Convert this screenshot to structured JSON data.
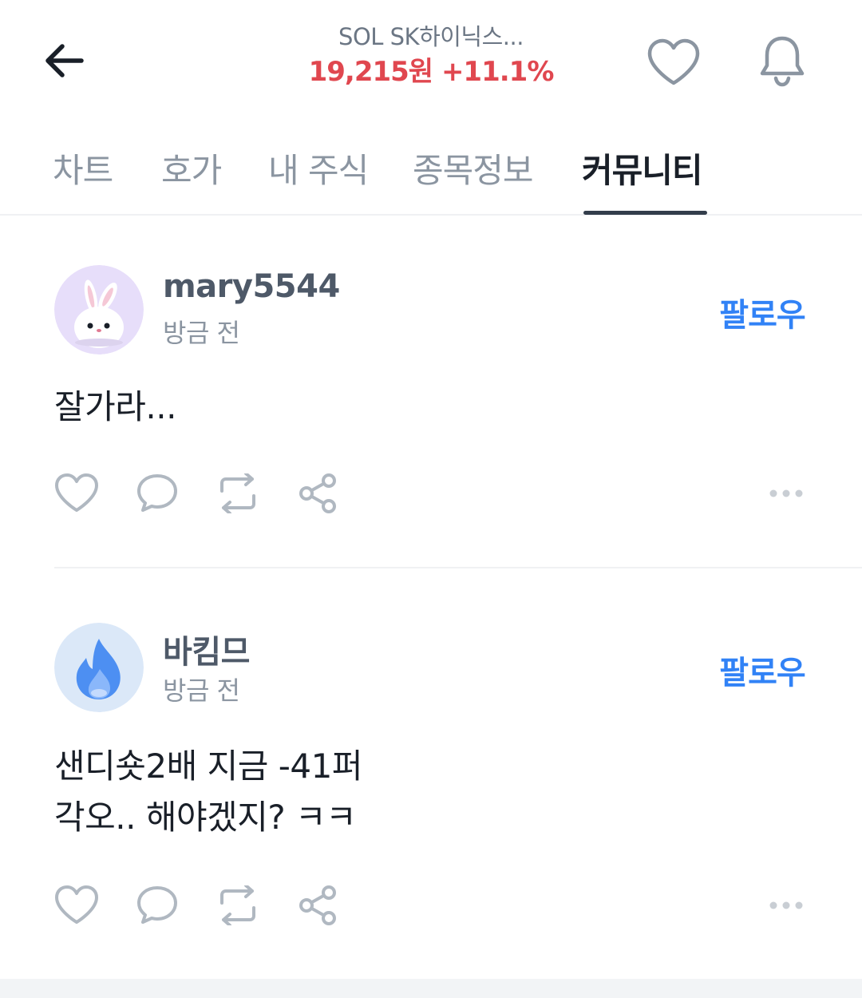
{
  "header": {
    "stock_name": "SOL SK하이닉스...",
    "price": "19,215원",
    "change": "+11.1%",
    "price_color": "#e0474f"
  },
  "tabs": [
    {
      "label": "차트",
      "active": false
    },
    {
      "label": "호가",
      "active": false
    },
    {
      "label": "내 주식",
      "active": false
    },
    {
      "label": "종목정보",
      "active": false
    },
    {
      "label": "커뮤니티",
      "active": true
    }
  ],
  "posts": [
    {
      "username": "mary5544",
      "time": "방금 전",
      "follow_label": "팔로우",
      "text_lines": [
        "잘가라..."
      ],
      "avatar": "bunny-avatar"
    },
    {
      "username": "바킴므",
      "time": "방금 전",
      "follow_label": "팔로우",
      "text_lines": [
        "샌디숏2배 지금 -41퍼",
        "각오.. 해야겠지? ㅋㅋ"
      ],
      "avatar": "flame-avatar"
    }
  ],
  "colors": {
    "accent": "#3182f6",
    "price_up": "#e0474f",
    "icon_gray": "#b0b8c1"
  },
  "icons": [
    "back-arrow-icon",
    "heart-icon",
    "bell-icon",
    "like-icon",
    "comment-icon",
    "repost-icon",
    "share-icon",
    "more-icon"
  ]
}
